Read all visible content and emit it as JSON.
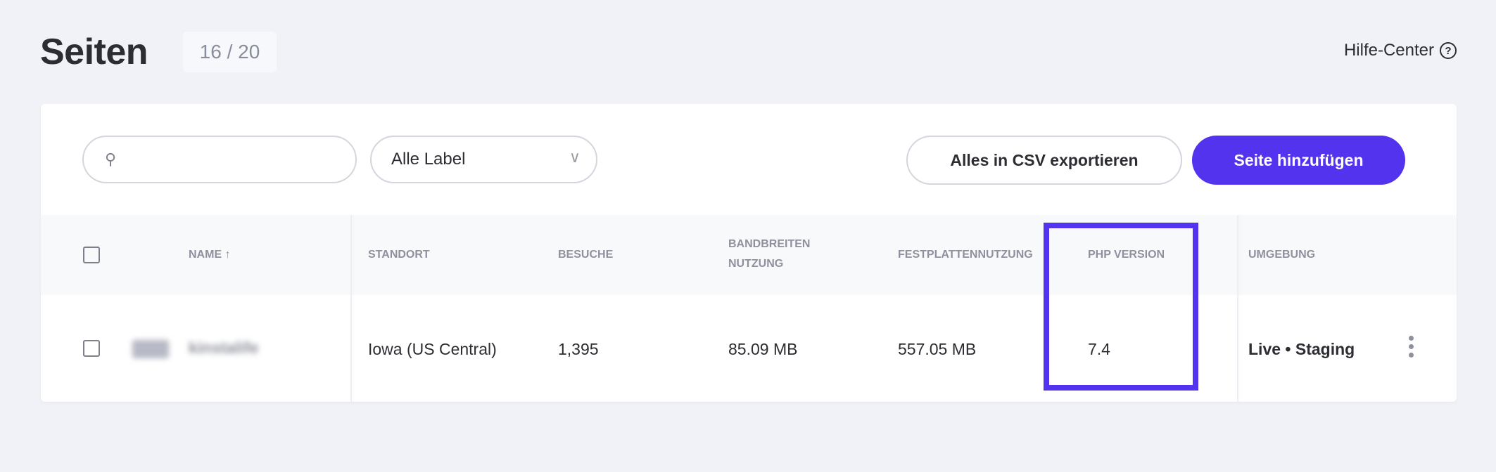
{
  "header": {
    "title": "Seiten",
    "count": "16 / 20",
    "help_label": "Hilfe-Center",
    "help_icon": "?"
  },
  "toolbar": {
    "search_placeholder": "",
    "search_icon": "⚲",
    "filter_value": "Alle Label",
    "filter_chevron": "∨",
    "export_label": "Alles in CSV exportieren",
    "add_label": "Seite hinzufügen"
  },
  "colors": {
    "accent": "#5333ed"
  },
  "table": {
    "columns": {
      "name": "NAME ↑",
      "location": "STANDORT",
      "visits": "BESUCHE",
      "bandwidth": "BANDBREITEN NUTZUNG",
      "disk": "FESTPLATTENNUTZUNG",
      "php": "PHP VERSION",
      "env": "UMGEBUNG"
    },
    "rows": [
      {
        "name": "kinstalife",
        "location": "Iowa (US Central)",
        "visits": "1,395",
        "bandwidth": "85.09 MB",
        "disk": "557.05 MB",
        "php": "7.4",
        "env": "Live • Staging"
      }
    ]
  }
}
